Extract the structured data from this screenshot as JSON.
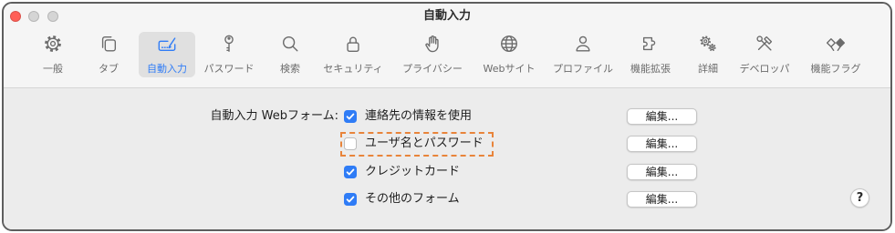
{
  "theme": {
    "accent": "#2f7cf6",
    "close_button": "#ff5f57",
    "inactive_button": "#d5d5d5",
    "highlight_border": "#e8843a"
  },
  "window": {
    "title": "自動入力"
  },
  "toolbar": {
    "items": [
      {
        "label": "一般",
        "icon": "gear-icon",
        "selected": false
      },
      {
        "label": "タブ",
        "icon": "tabs-icon",
        "selected": false
      },
      {
        "label": "自動入力",
        "icon": "autofill-form-icon",
        "selected": true
      },
      {
        "label": "パスワード",
        "icon": "key-icon",
        "selected": false
      },
      {
        "label": "検索",
        "icon": "search-icon",
        "selected": false
      },
      {
        "label": "セキュリティ",
        "icon": "lock-icon",
        "selected": false
      },
      {
        "label": "プライバシー",
        "icon": "hand-icon",
        "selected": false
      },
      {
        "label": "Webサイト",
        "icon": "globe-icon",
        "selected": false
      },
      {
        "label": "プロファイル",
        "icon": "person-icon",
        "selected": false
      },
      {
        "label": "機能拡張",
        "icon": "extension-icon",
        "selected": false
      },
      {
        "label": "詳細",
        "icon": "gears-icon",
        "selected": false
      },
      {
        "label": "デベロッパ",
        "icon": "tools-icon",
        "selected": false
      },
      {
        "label": "機能フラグ",
        "icon": "flags-icon",
        "selected": false
      }
    ]
  },
  "autofill": {
    "section_label": "自動入力 Webフォーム:",
    "options": [
      {
        "label": "連絡先の情報を使用",
        "checked": true,
        "highlighted": false,
        "edit_button": "編集..."
      },
      {
        "label": "ユーザ名とパスワード",
        "checked": false,
        "highlighted": true,
        "edit_button": "編集..."
      },
      {
        "label": "クレジットカード",
        "checked": true,
        "highlighted": false,
        "edit_button": "編集..."
      },
      {
        "label": "その他のフォーム",
        "checked": true,
        "highlighted": false,
        "edit_button": "編集..."
      }
    ]
  },
  "help_button": {
    "label": "?"
  }
}
